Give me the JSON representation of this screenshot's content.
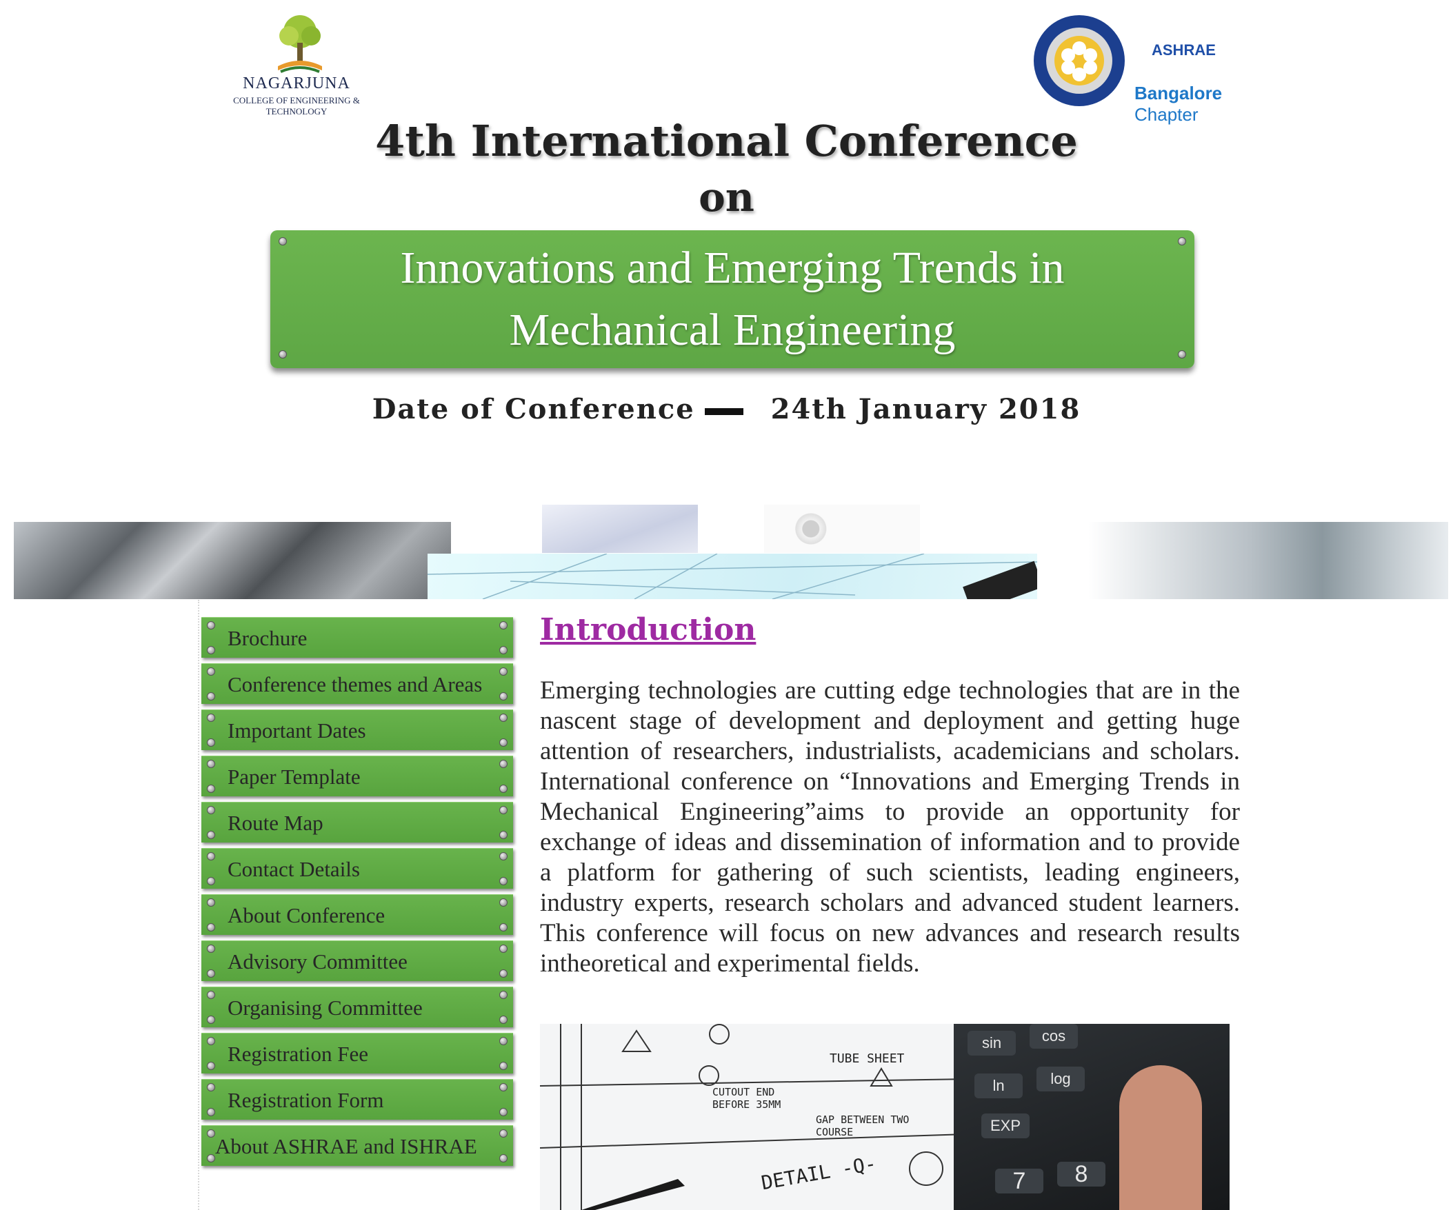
{
  "logos": {
    "college_name": "NAGARJUNA",
    "college_sub": "COLLEGE OF ENGINEERING & TECHNOLOGY",
    "ashrae": "ASHRAE",
    "chapter_city": "Bangalore",
    "chapter_word": "Chapter"
  },
  "header": {
    "title_line1": "4th International Conference",
    "title_line2": "on",
    "banner_line1": "Innovations and Emerging Trends in",
    "banner_line2": "Mechanical Engineering",
    "date_label": "Date of Conference",
    "date_value": "24th January 2018"
  },
  "sidebar": {
    "items": [
      {
        "label": "Brochure"
      },
      {
        "label": "Conference themes and Areas"
      },
      {
        "label": "Important Dates"
      },
      {
        "label": "Paper Template"
      },
      {
        "label": "Route Map"
      },
      {
        "label": "Contact Details"
      },
      {
        "label": "About Conference"
      },
      {
        "label": "Advisory Committee"
      },
      {
        "label": "Organising Committee"
      },
      {
        "label": "Registration Fee"
      },
      {
        "label": "Registration Form"
      },
      {
        "label": "About ASHRAE and ISHRAE"
      }
    ]
  },
  "main": {
    "heading": "Introduction",
    "body": "Emerging technologies are cutting edge technologies that are in the nascent stage of development and deployment and getting huge attention of researchers, industrialists, academicians and scholars. International conference on “Innovations and Emerging Trends in Mechanical Engineering”aims to provide an opportunity for exchange of ideas and dissemination of information and to provide a platform for gathering of such scientists, leading engineers, industry experts, research scholars and advanced student learners. This conference will focus on new advances and research results intheoretical and experimental fields."
  },
  "photo": {
    "notes": [
      "TUBE SHEET",
      "CUTOUT END BEFORE 35MM",
      "GAP BETWEEN TWO COURSE",
      "DETAIL -Q-"
    ],
    "keys": [
      "sin",
      "cos",
      "ln",
      "log",
      "EXP",
      "7",
      "8"
    ]
  },
  "colors": {
    "banner_green": "#5ea745",
    "nav_green": "#5ea745",
    "heading_purple": "#9e2aa2"
  }
}
